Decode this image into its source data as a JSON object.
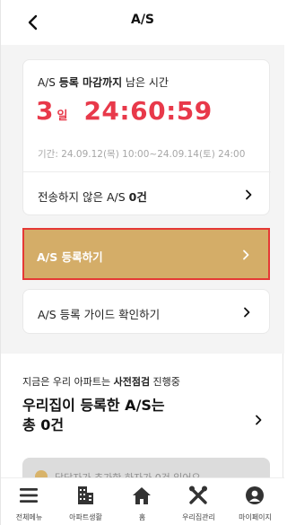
{
  "header": {
    "title": "A/S"
  },
  "deadline_card": {
    "deadline_prefix": "A/S ",
    "deadline_bold": "등록 마감까지",
    "deadline_suffix": " 남은 시간",
    "days_value": "3",
    "days_unit": "일",
    "countdown": "24:60:59",
    "period": "기간: 24.09.12(목) 10:00~24.09.14(토) 24:00",
    "unsent_prefix": "전송하지 않은 A/S ",
    "unsent_count": "0건"
  },
  "register_button": {
    "label": "A/S 등록하기"
  },
  "guide_button": {
    "label": "A/S 등록 가이드 확인하기"
  },
  "status_section": {
    "notice_prefix": "지금은 우리 아파트는 ",
    "notice_bold": "사전점검",
    "notice_suffix": " 진행중",
    "line1": "우리집이 등록한 A/S는",
    "line2": "총 0건",
    "peek_text": "담당자가 추가한 하자가 0건 있어요"
  },
  "bottom_nav": {
    "items": [
      {
        "label": "전체메뉴",
        "icon": "menu-icon"
      },
      {
        "label": "아파트생활",
        "icon": "apartment-icon"
      },
      {
        "label": "홈",
        "icon": "home-icon"
      },
      {
        "label": "우리집관리",
        "icon": "tools-icon"
      },
      {
        "label": "마이페이지",
        "icon": "profile-icon"
      }
    ]
  },
  "colors": {
    "accent_red": "#e8394a",
    "button_gold": "#d4ad68",
    "highlight_border": "#e53935"
  }
}
